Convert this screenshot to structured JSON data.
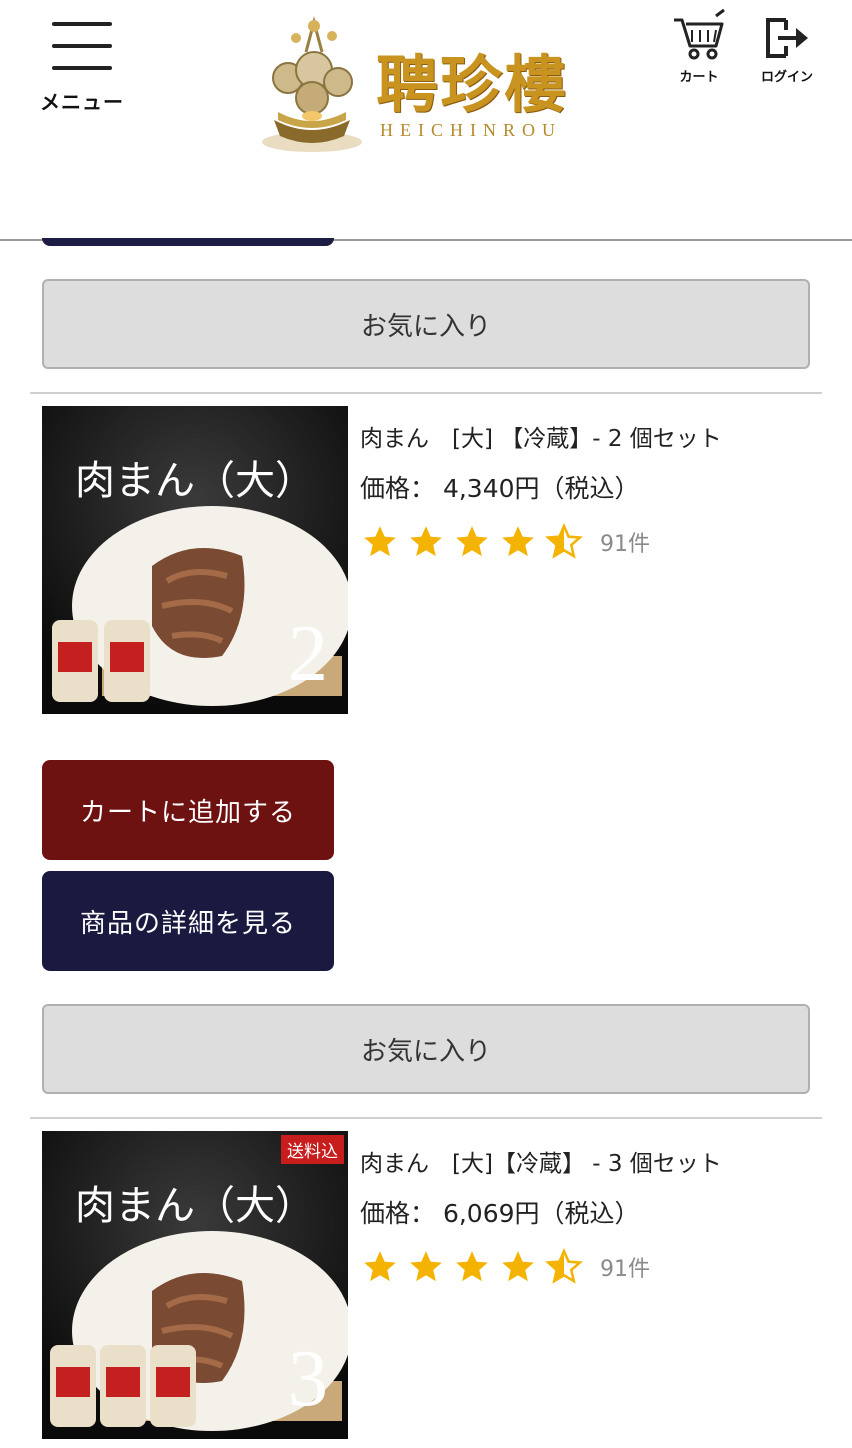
{
  "header": {
    "menu_label": "メニュー",
    "logo_title": "聘珍樓",
    "logo_subtitle": "HEICHINROU",
    "cart_label": "カート",
    "login_label": "ログイン"
  },
  "favorite_label": "お気に入り",
  "products": [
    {
      "name": "肉まん　[大] 【冷蔵】- 2 個セット",
      "price": "価格： 4,340円（税込）",
      "rating": 4.5,
      "review_count": "91件",
      "image_title": "肉まん（大）",
      "image_number": "2",
      "image_badge": "",
      "add_to_cart_label": "カートに追加する",
      "detail_label": "商品の詳細を見る"
    },
    {
      "name": "肉まん　[大]【冷蔵】 - 3 個セット",
      "price": "価格： 6,069円（税込）",
      "rating": 4.5,
      "review_count": "91件",
      "image_title": "肉まん（大）",
      "image_number": "3",
      "image_badge": "送料込"
    }
  ],
  "colors": {
    "star": "#f5b301",
    "cart_button": "#6e1111",
    "detail_button": "#1a1a40",
    "favorite_button": "#dddddd"
  }
}
